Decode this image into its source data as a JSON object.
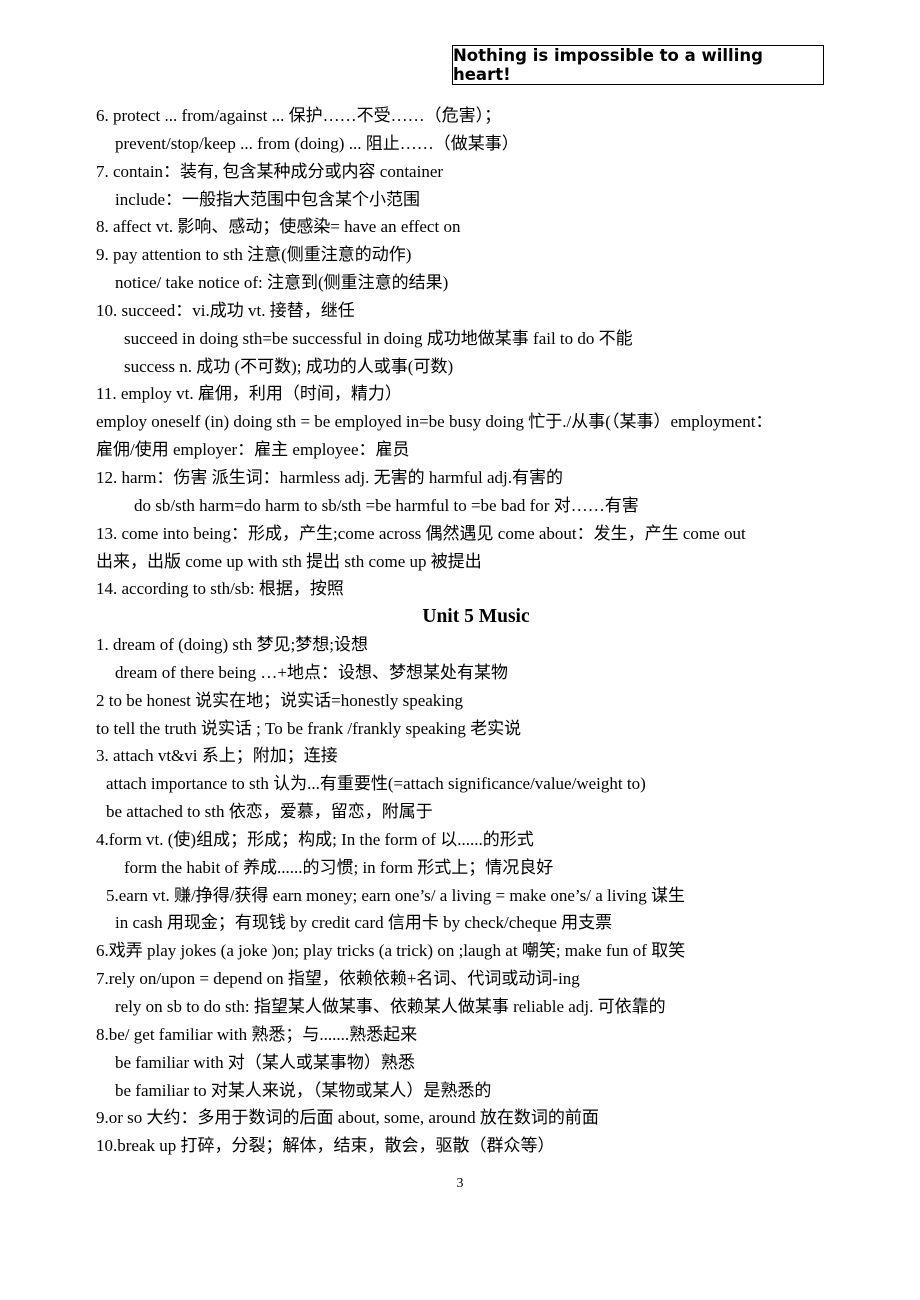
{
  "header": {
    "motto": "Nothing is impossible to a willing heart!"
  },
  "lines": [
    "6. protect ... from/against ...  保护……不受……（危害）；",
    "prevent/stop/keep ... from (doing) ...  阻止……（做某事）",
    "7. contain：装有, 包含某种成分或内容 container",
    "include：一般指大范围中包含某个小范围",
    "8. affect vt.  影响、感动；使感染= have an effect on",
    "9. pay attention to sth 注意(侧重注意的动作)",
    "notice/ take notice of:  注意到(侧重注意的结果)",
    "10. succeed：vi.成功  vt. 接替，继任",
    "succeed in doing sth=be successful in doing 成功地做某事    fail to do  不能",
    "success n.  成功  (不可数);  成功的人或事(可数)",
    "11. employ vt.  雇佣，利用（时间，精力）",
    "employ oneself (in) doing sth = be employed in=be busy doing  忙于./从事(（某事）employment：",
    "雇佣/使用  employer：雇主  employee：雇员",
    "12. harm：伤害    派生词：harmless adj.  无害的  harmful adj.有害的",
    "do sb/sth harm=do harm to sb/sth =be harmful to =be bad for  对……有害",
    "13. come into being：形成，产生;come across  偶然遇见    come about：发生，产生    come out",
    "出来，出版  come up with sth 提出    sth come up  被提出",
    "14.    according to sth/sb:  根据，按照",
    "Unit 5 Music",
    "1. dream of (doing) sth 梦见;梦想;设想",
    "dream of there being …+地点：设想、梦想某处有某物",
    "2 to be honest  说实在地；说实话=honestly speaking",
    "to tell the truth  说实话  ; To be frank /frankly speaking  老实说",
    "3.    attach vt&vi  系上；附加；连接",
    "attach importance to sth 认为...有重要性(=attach significance/value/weight to)",
    "be attached to sth  依恋，爱慕，留恋，附属于",
    "4.form vt. (使)组成；形成；构成; In the form of  以......的形式",
    "form the habit of  养成......的习惯;    in form  形式上；情况良好",
    "5.earn vt.  赚/挣得/获得  earn money; earn one’s/ a living = make one’s/ a living  谋生",
    "in cash  用现金；有现钱    by credit card  信用卡  by check/cheque 用支票",
    "6.戏弄 play jokes (a joke )on; play tricks (a trick) on ;laugh at 嘲笑; make fun of 取笑",
    "7.rely on/upon = depend on    指望，依赖依赖+名词、代词或动词-ing",
    "rely on sb to do sth:  指望某人做某事、依赖某人做某事      reliable adj.  可依靠的",
    "8.be/ get familiar with  熟悉；与.......熟悉起来",
    "be familiar with  对（某人或某事物）熟悉",
    "be familiar to  对某人来说，（某物或某人）是熟悉的",
    "9.or so  大约：多用于数词的后面 about, some, around  放在数词的前面",
    "10.break up  打碎，分裂；解体，结束，散会，驱散（群众等）"
  ],
  "page_number": "3"
}
